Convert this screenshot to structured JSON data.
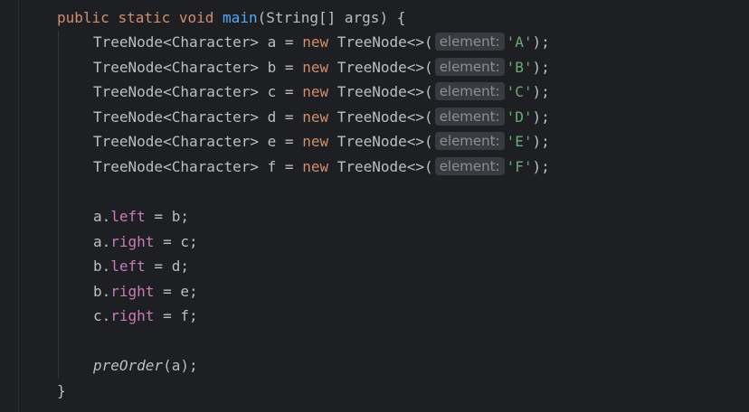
{
  "code": {
    "signature": {
      "kw_public": "public",
      "kw_static": "static",
      "kw_void": "void",
      "method_name": "main",
      "params": "(String[] args) {"
    },
    "declarations": [
      {
        "type": "TreeNode<Character> ",
        "var": "a = ",
        "kw_new": "new",
        "ctor": " TreeNode<>(",
        "hint": "element:",
        "arg": "'A'",
        "tail": ");"
      },
      {
        "type": "TreeNode<Character> ",
        "var": "b = ",
        "kw_new": "new",
        "ctor": " TreeNode<>(",
        "hint": "element:",
        "arg": "'B'",
        "tail": ");"
      },
      {
        "type": "TreeNode<Character> ",
        "var": "c = ",
        "kw_new": "new",
        "ctor": " TreeNode<>(",
        "hint": "element:",
        "arg": "'C'",
        "tail": ");"
      },
      {
        "type": "TreeNode<Character> ",
        "var": "d = ",
        "kw_new": "new",
        "ctor": " TreeNode<>(",
        "hint": "element:",
        "arg": "'D'",
        "tail": ");"
      },
      {
        "type": "TreeNode<Character> ",
        "var": "e = ",
        "kw_new": "new",
        "ctor": " TreeNode<>(",
        "hint": "element:",
        "arg": "'E'",
        "tail": ");"
      },
      {
        "type": "TreeNode<Character> ",
        "var": "f = ",
        "kw_new": "new",
        "ctor": " TreeNode<>(",
        "hint": "element:",
        "arg": "'F'",
        "tail": ");"
      }
    ],
    "assignments": [
      {
        "obj": "a.",
        "field": "left",
        "rest": " = b;"
      },
      {
        "obj": "a.",
        "field": "right",
        "rest": " = c;"
      },
      {
        "obj": "b.",
        "field": "left",
        "rest": " = d;"
      },
      {
        "obj": "b.",
        "field": "right",
        "rest": " = e;"
      },
      {
        "obj": "c.",
        "field": "right",
        "rest": " = f;"
      }
    ],
    "call": {
      "method": "preOrder",
      "args": "(a);"
    },
    "closing_brace": "}"
  },
  "colors": {
    "background": "#1e1f22",
    "keyword": "#cf8e6d",
    "method_declaration": "#56a8f5",
    "field": "#c77dbb",
    "string": "#6aab73",
    "default_text": "#bcbec4",
    "inlay_hint_bg": "#393b40",
    "inlay_hint_text": "#8c8f94"
  }
}
